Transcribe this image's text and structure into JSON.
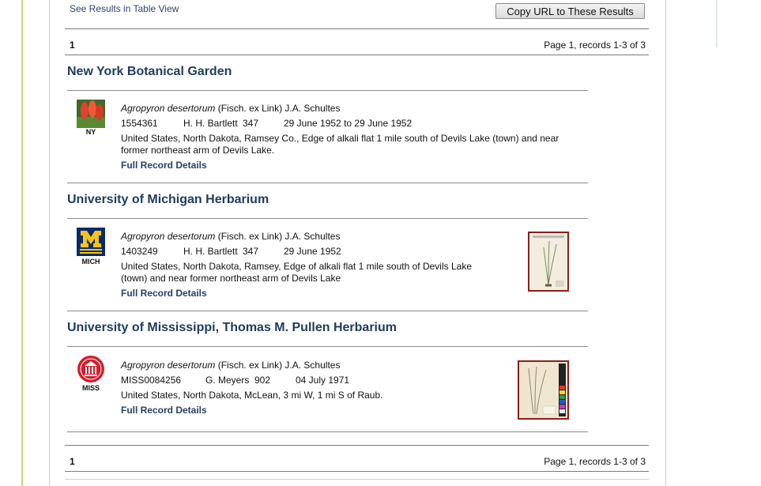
{
  "top": {
    "table_view_link": "See Results in Table View",
    "copy_url_button": "Copy URL to These Results"
  },
  "pager_top": {
    "page": "1",
    "info": "Page 1, records 1-3 of 3"
  },
  "pager_bottom": {
    "page": "1",
    "info": "Page 1, records 1-3 of 3"
  },
  "records": [
    {
      "institution": "New York Botanical Garden",
      "code": "NY",
      "logo_icon": "flower-photo-icon",
      "taxon": "Agropyron desertorum",
      "author": "(Fisch. ex Link) J.A. Schultes",
      "catalog": "1554361",
      "collector": "H. H. Bartlett",
      "number": "347",
      "date": "29 June 1952 to 29 June 1952",
      "locality_1": "United States, North Dakota, Ramsey Co., Edge of alkali flat 1 mile south of Devils Lake (town) and near",
      "locality_2": "former northeast arm of Devils Lake.",
      "details": "Full Record Details",
      "has_thumb": false
    },
    {
      "institution": "University of Michigan Herbarium",
      "code": "MICH",
      "logo_icon": "michigan-m-logo-icon",
      "taxon": "Agropyron desertorum",
      "author": "(Fisch. ex Link) J.A. Schultes",
      "catalog": "1403249",
      "collector": "H. H. Bartlett",
      "number": "347",
      "date": "29 June 1952",
      "locality_1": "United States, North Dakota, Ramsey, Edge of alkali flat 1 mile south of Devils Lake",
      "locality_2": "(town) and near former northeast arm of Devils Lake",
      "details": "Full Record Details",
      "has_thumb": true
    },
    {
      "institution": "University of Mississippi, Thomas M. Pullen Herbarium",
      "code": "MISS",
      "logo_icon": "mississippi-seal-logo-icon",
      "taxon": "Agropyron desertorum",
      "author": "(Fisch. ex Link) J.A. Schultes",
      "catalog": "MISS0084256",
      "collector": "G. Meyers",
      "number": "902",
      "date": "04 July 1971",
      "locality_1": "United States, North Dakota, McLean, 3 mi W, 1 mi S of Raub.",
      "locality_2": "",
      "details": "Full Record Details",
      "has_thumb": true
    }
  ],
  "colors": {
    "title": "#1f3a5f",
    "link": "#2a3f63",
    "thumb_border": "#8a1f1f"
  }
}
